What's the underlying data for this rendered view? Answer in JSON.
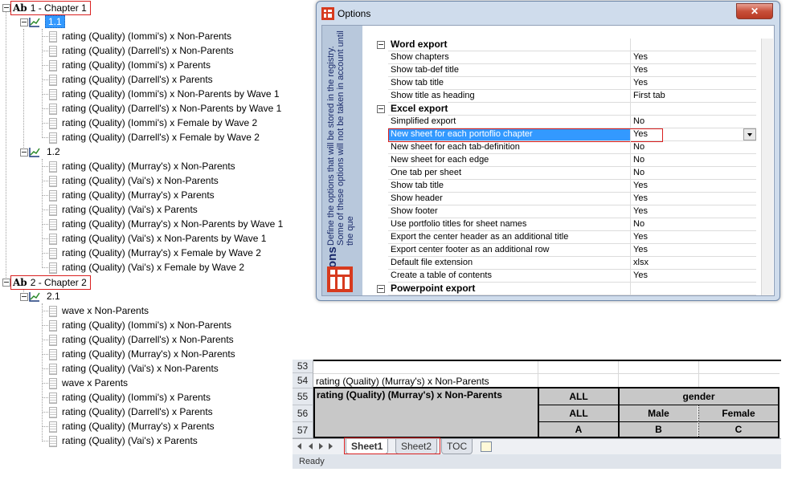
{
  "tree": {
    "chapters": [
      {
        "ab": "Ab",
        "label": "1 - Chapter 1",
        "sections": [
          {
            "label": "1.1",
            "items": [
              "rating (Quality) (Iommi's) x Non-Parents",
              "rating (Quality) (Darrell's) x Non-Parents",
              "rating (Quality) (Iommi's) x Parents",
              "rating (Quality) (Darrell's) x Parents",
              "rating (Quality) (Iommi's) x Non-Parents by Wave 1",
              "rating (Quality) (Darrell's) x Non-Parents by Wave 1",
              "rating (Quality) (Iommi's) x Female by Wave 2",
              "rating (Quality) (Darrell's) x Female by Wave 2"
            ]
          },
          {
            "label": "1.2",
            "items": [
              "rating (Quality) (Murray's) x Non-Parents",
              "rating (Quality) (Vai's) x Non-Parents",
              "rating (Quality) (Murray's) x Parents",
              "rating (Quality) (Vai's) x Parents",
              "rating (Quality) (Murray's) x Non-Parents by Wave 1",
              "rating (Quality) (Vai's) x Non-Parents by Wave 1",
              "rating (Quality) (Murray's) x Female by Wave 2",
              "rating (Quality) (Vai's) x Female by Wave 2"
            ]
          }
        ]
      },
      {
        "ab": "Ab",
        "label": "2 - Chapter 2",
        "sections": [
          {
            "label": "2.1",
            "items": [
              "wave x Non-Parents",
              "rating (Quality) (Iommi's) x Non-Parents",
              "rating (Quality) (Darrell's) x Non-Parents",
              "rating (Quality) (Murray's) x Non-Parents",
              "rating (Quality) (Vai's) x Non-Parents",
              "wave x Parents",
              "rating (Quality) (Iommi's) x Parents",
              "rating (Quality) (Darrell's) x Parents",
              "rating (Quality) (Murray's) x Parents",
              "rating (Quality) (Vai's) x Parents"
            ]
          }
        ]
      }
    ]
  },
  "dialog": {
    "title": "Options",
    "close": "✕",
    "side_title": "Options",
    "side_desc": "Define the options that will be stored in the registry. Some of these options will not be taken in account until the que",
    "rows": [
      {
        "type": "category",
        "label": "Word export"
      },
      {
        "type": "option",
        "label": "Show chapters",
        "value": "Yes"
      },
      {
        "type": "option",
        "label": "Show tab-def title",
        "value": "Yes"
      },
      {
        "type": "option",
        "label": "Show tab title",
        "value": "Yes"
      },
      {
        "type": "option",
        "label": "Show title as heading",
        "value": "First tab"
      },
      {
        "type": "category",
        "label": "Excel export"
      },
      {
        "type": "option",
        "label": "Simplified export",
        "value": "No"
      },
      {
        "type": "option",
        "label": "New sheet for each portoflio chapter",
        "value": "Yes",
        "selected": true
      },
      {
        "type": "option",
        "label": "New sheet for each tab-definition",
        "value": "No"
      },
      {
        "type": "option",
        "label": "New sheet for each edge",
        "value": "No"
      },
      {
        "type": "option",
        "label": "One tab per sheet",
        "value": "No"
      },
      {
        "type": "option",
        "label": "Show tab title",
        "value": "Yes"
      },
      {
        "type": "option",
        "label": "Show header",
        "value": "Yes"
      },
      {
        "type": "option",
        "label": "Show footer",
        "value": "Yes"
      },
      {
        "type": "option",
        "label": "Use portfolio titles for sheet names",
        "value": "No"
      },
      {
        "type": "option",
        "label": "Export the center header as an additional title",
        "value": "Yes"
      },
      {
        "type": "option",
        "label": "Export center footer as an additional row",
        "value": "Yes"
      },
      {
        "type": "option",
        "label": "Default file extension",
        "value": "xlsx"
      },
      {
        "type": "option",
        "label": "Create a table of contents",
        "value": "Yes"
      },
      {
        "type": "category",
        "label": "Powerpoint export"
      }
    ]
  },
  "excel": {
    "rows": [
      "53",
      "54",
      "55",
      "56",
      "57"
    ],
    "row54_text": "rating (Quality) (Murray's) x Non-Parents",
    "table_title": "rating (Quality) (Murray's) x Non-Parents",
    "all_header": "ALL",
    "gender_header": "gender",
    "all_sub": "ALL",
    "male": "Male",
    "female": "Female",
    "col_a": "A",
    "col_b": "B",
    "col_c": "C",
    "tabs": [
      "Sheet1",
      "Sheet2",
      "TOC"
    ],
    "status": "Ready"
  }
}
